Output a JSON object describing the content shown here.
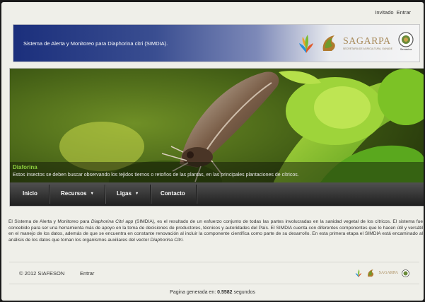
{
  "topbar": {
    "user": "Invitado",
    "login": "Entrar"
  },
  "header": {
    "title": "Sistema de Alerta y Monitoreo para Diaphorina citri (SIMDIA).",
    "logos": {
      "org": "SAGARPA",
      "org_sub": "SECRETARÍA DE AGRICULTURA, GANADERÍA, DESARROLLO RURAL, PESCA Y ALIMENTACIÓN",
      "seal": "Senasica"
    }
  },
  "hero": {
    "title": "Diaforina",
    "text": "Estos insectos se deben buscar observando los tejidos tiernos o retoños de las plantas, en las principales plantaciones de cítricos."
  },
  "menu": {
    "items": [
      {
        "label": "Inicio"
      },
      {
        "label": "Recursos"
      },
      {
        "label": "Ligas"
      },
      {
        "label": "Contacto"
      }
    ]
  },
  "description": {
    "p1": "El Sistema de Alerta y Monitoreo para ",
    "species1": "Diaphorina Citri app",
    "p2": " (SIMDIA), es el resultado de un esfuerzo conjunto de todas las partes involucradas en la sanidad vegetal de los cítricos. El sistema fue concebido para ser una herramienta más de apoyo en la toma de decisiones de productores, técnicos y autoridades del País. El SIMDIA cuenta con diferentes componentes que lo hacen útil y versátil en el manejo de los datos, además de que se encuentra en constante renovación al incluir la componente científica como parte de su desarrollo. En esta primera etapa el SIMDIA está encaminado al análisis de los datos que toman los organismos auxiliares del vector ",
    "species2": "Diaphorina Citri",
    "p3": "."
  },
  "footer": {
    "copyright": "© 2012 SIAFESON",
    "login": "Entrar",
    "sagarpa": "SAGARPA"
  },
  "generated": {
    "prefix": "Pagina generada en:",
    "value": "0.5582",
    "suffix": "segundos"
  }
}
